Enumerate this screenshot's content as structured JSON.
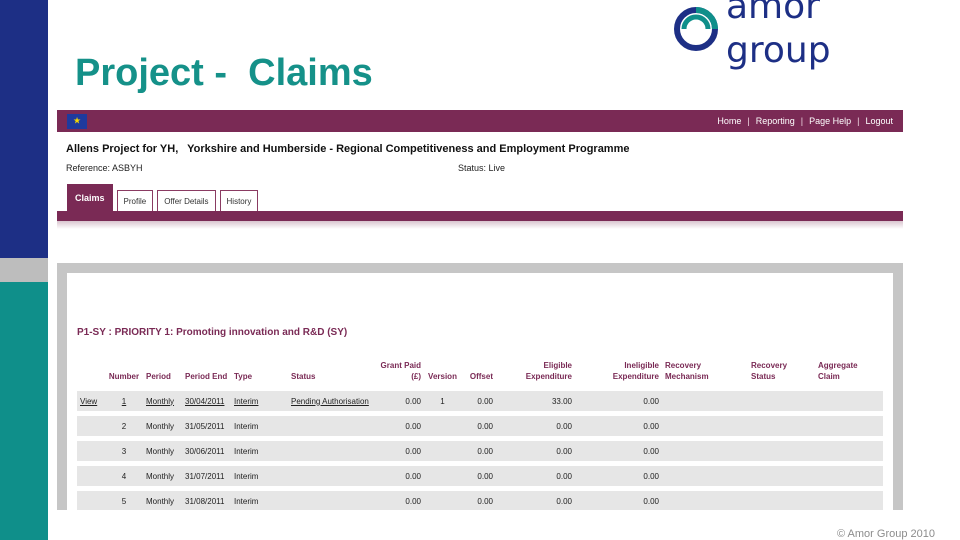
{
  "slide": {
    "title": "Project -  Claims",
    "logo_text": "amor group",
    "copyright": "© Amor Group 2010",
    "colors": {
      "navy": "#1d2f85",
      "teal": "#0f8f8a",
      "title": "#159189",
      "maroon": "#7a2a55"
    }
  },
  "app": {
    "nav": {
      "home": "Home",
      "reporting": "Reporting",
      "page_help": "Page Help",
      "logout": "Logout",
      "separator": "|"
    },
    "project": {
      "name": "Allens Project for YH,",
      "programme": "Yorkshire and Humberside - Regional Competitiveness and Employment Programme",
      "reference": "Reference: ASBYH",
      "status": "Status: Live"
    },
    "tabs": [
      {
        "label": "Claims",
        "active": true
      },
      {
        "label": "Profile",
        "active": false
      },
      {
        "label": "Offer Details",
        "active": false
      },
      {
        "label": "History",
        "active": false
      }
    ],
    "section_title": "P1-SY : PRIORITY 1: Promoting innovation and R&D (SY)",
    "table": {
      "headers": {
        "number": "Number",
        "period": "Period",
        "period_end": "Period End",
        "type": "Type",
        "status": "Status",
        "grant_paid_1": "Grant Paid",
        "grant_paid_2": "(£)",
        "version": "Version",
        "offset": "Offset",
        "eligible_1": "Eligible",
        "eligible_2": "Expenditure",
        "ineligible_1": "Ineligible",
        "ineligible_2": "Expenditure",
        "recovery_mech_1": "Recovery",
        "recovery_mech_2": "Mechanism",
        "recovery_status_1": "Recovery",
        "recovery_status_2": "Status",
        "aggregate_1": "Aggregate",
        "aggregate_2": "Claim"
      },
      "rows": [
        {
          "action": "View",
          "number": "1",
          "period": "Monthly",
          "period_end": "30/04/2011",
          "type": "Interim",
          "status": "Pending Authorisation",
          "grant_paid": "0.00",
          "version": "1",
          "offset": "0.00",
          "eligible": "33.00",
          "ineligible": "0.00"
        },
        {
          "action": "",
          "number": "2",
          "period": "Monthly",
          "period_end": "31/05/2011",
          "type": "Interim",
          "status": "",
          "grant_paid": "0.00",
          "version": "",
          "offset": "0.00",
          "eligible": "0.00",
          "ineligible": "0.00"
        },
        {
          "action": "",
          "number": "3",
          "period": "Monthly",
          "period_end": "30/06/2011",
          "type": "Interim",
          "status": "",
          "grant_paid": "0.00",
          "version": "",
          "offset": "0.00",
          "eligible": "0.00",
          "ineligible": "0.00"
        },
        {
          "action": "",
          "number": "4",
          "period": "Monthly",
          "period_end": "31/07/2011",
          "type": "Interim",
          "status": "",
          "grant_paid": "0.00",
          "version": "",
          "offset": "0.00",
          "eligible": "0.00",
          "ineligible": "0.00"
        },
        {
          "action": "",
          "number": "5",
          "period": "Monthly",
          "period_end": "31/08/2011",
          "type": "Interim",
          "status": "",
          "grant_paid": "0.00",
          "version": "",
          "offset": "0.00",
          "eligible": "0.00",
          "ineligible": "0.00"
        }
      ]
    }
  }
}
